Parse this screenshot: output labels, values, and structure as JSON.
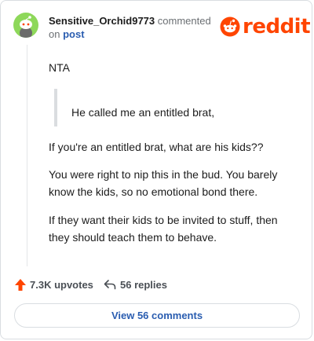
{
  "comment": {
    "username": "Sensitive_Orchid9773",
    "commented_text": "commented",
    "on_text": "on",
    "post_link": "post",
    "brand": "reddit",
    "paragraphs": {
      "verdict": "NTA",
      "quote": "He called me an entitled brat,",
      "p1": "If you're an entitled brat, what are his kids??",
      "p2": "You were right to nip this in the bud. You barely know the kids, so no emotional bond there.",
      "p3": "If they want their kids to be invited to stuff, then they should teach them to behave."
    }
  },
  "footer": {
    "upvotes": "7.3K upvotes",
    "replies": "56 replies",
    "view_button": "View 56 comments"
  },
  "colors": {
    "accent": "#ff4500",
    "link": "#2a5db0",
    "avatar_bg": "#8ed85a"
  },
  "icons": {
    "avatar": "snoo-avatar",
    "logo": "reddit-logo-icon",
    "upvote": "upvote-arrow-icon",
    "reply": "reply-arrow-icon"
  }
}
